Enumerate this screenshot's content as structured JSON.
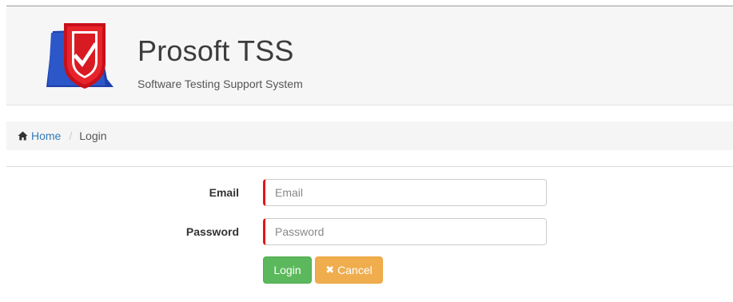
{
  "header": {
    "title": "Prosoft TSS",
    "subtitle": "Software Testing Support System",
    "logo_colors": {
      "blue": "#2b57c9",
      "red": "#d8121b"
    }
  },
  "breadcrumb": {
    "home_label": "Home",
    "home_icon": "home-icon",
    "separator": "/",
    "current": "Login"
  },
  "form": {
    "email_label": "Email",
    "email_placeholder": "Email",
    "email_value": "",
    "password_label": "Password",
    "password_placeholder": "Password",
    "password_value": "",
    "login_button": "Login",
    "cancel_icon": "close-icon",
    "cancel_button": "Cancel"
  },
  "colors": {
    "link": "#337ab7",
    "success": "#5cb85c",
    "warning": "#f0ad4e",
    "required_marker": "#e0161a"
  }
}
